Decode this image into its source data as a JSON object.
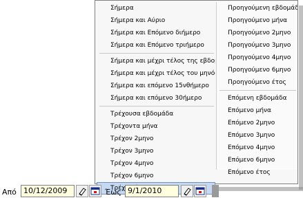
{
  "menu": {
    "left_groups": [
      [
        {
          "label": "Σήμερα"
        },
        {
          "label": "Σήμερα και Αύριο"
        },
        {
          "label": "Σήμερα και Επόμενο διήμερο"
        },
        {
          "label": "Σήμερα και Επόμενο τριήμερο"
        }
      ],
      [
        {
          "label": "Σήμερα και μέχρι τέλος της εβδομάδας"
        },
        {
          "label": "Σήμερα και μέχρι τέλος του μηνός"
        },
        {
          "label": "Σήμερα και επόμενο 15νθήμερο"
        },
        {
          "label": "Σήμερα και επόμενο 30ήμερο"
        }
      ],
      [
        {
          "label": "Τρέχουσα εβδομάδα"
        },
        {
          "label": "Τρέχοντα μήνα"
        },
        {
          "label": "Τρέχον 2μηνο"
        },
        {
          "label": "Τρέχον 3μηνο"
        },
        {
          "label": "Τρέχον 4μηνο"
        },
        {
          "label": "Τρέχον 6μηνο"
        },
        {
          "label": "Τρέχον έτος",
          "selected": true
        }
      ]
    ],
    "right_groups": [
      [
        {
          "label": "Προηγούμενη εβδομάδα"
        },
        {
          "label": "Προηγούμενο μήνα"
        },
        {
          "label": "Προηγούμενο 2μηνο"
        },
        {
          "label": "Προηγούμενο 3μηνο"
        },
        {
          "label": "Προηγούμενο 4μηνο"
        },
        {
          "label": "Προηγούμενο 6μηνο"
        },
        {
          "label": "Προηγούμενο έτος"
        }
      ],
      [
        {
          "label": "Επόμενη εβδομάδα"
        },
        {
          "label": "Επόμενο μήνα"
        },
        {
          "label": "Επόμενο 2μηνο"
        },
        {
          "label": "Επόμενο 3μηνο"
        },
        {
          "label": "Επόμενο 4μηνο"
        },
        {
          "label": "Επόμενο 6μηνο"
        },
        {
          "label": "Επόμενο έτος"
        }
      ]
    ]
  },
  "filter": {
    "from_label": "Από",
    "from_value": "10/12/2009",
    "to_label": "Έως",
    "to_value": "9/1/2010"
  },
  "icons": {
    "clear": "eraser-icon",
    "calendar": "calendar-icon"
  },
  "colors": {
    "selected_item": "#c6d9f2",
    "date_field": "#ffffe0"
  }
}
